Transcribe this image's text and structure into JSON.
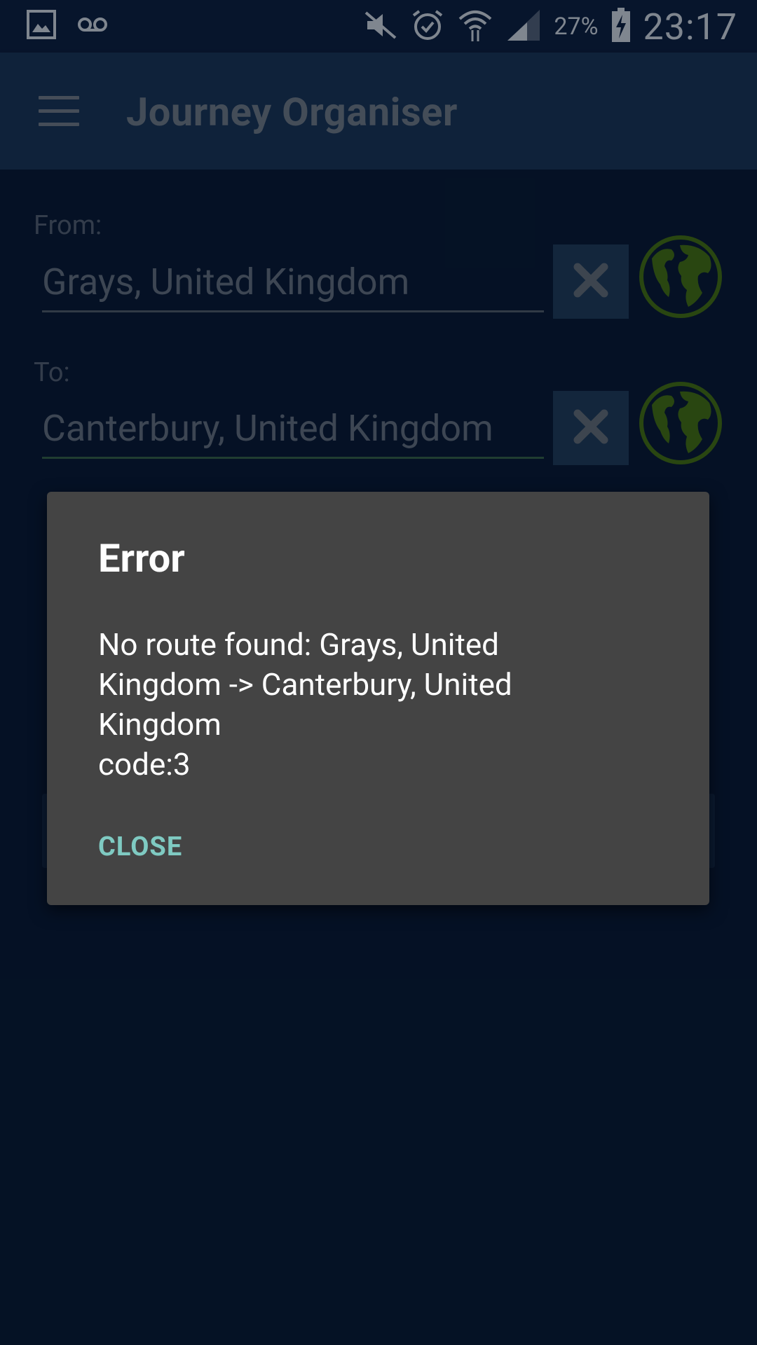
{
  "status_bar": {
    "battery_percent": "27%",
    "time": "23:17",
    "icons": [
      "gallery-icon",
      "voicemail-icon",
      "mute-icon",
      "alarm-icon",
      "wifi-icon",
      "signal-icon",
      "battery-charging-icon"
    ]
  },
  "app_bar": {
    "title": "Journey Organiser",
    "menu_icon": "hamburger-menu-icon"
  },
  "form": {
    "from": {
      "label": "From:",
      "value": "Grays, United Kingdom"
    },
    "to": {
      "label": "To:",
      "value": "Canterbury, United Kingdom"
    },
    "clear_icon": "close-x-icon",
    "globe_icon": "globe-icon"
  },
  "dialog": {
    "title": "Error",
    "message": "No route found: Grays, United\nKingdom -> Canterbury, United\nKingdom\ncode:3",
    "close_label": "CLOSE"
  },
  "colors": {
    "background": "#0a1a33",
    "app_bar": "#1d3a5a",
    "dialog": "#444444",
    "accent": "#7fcac2",
    "globe": "#4b7a0f"
  }
}
